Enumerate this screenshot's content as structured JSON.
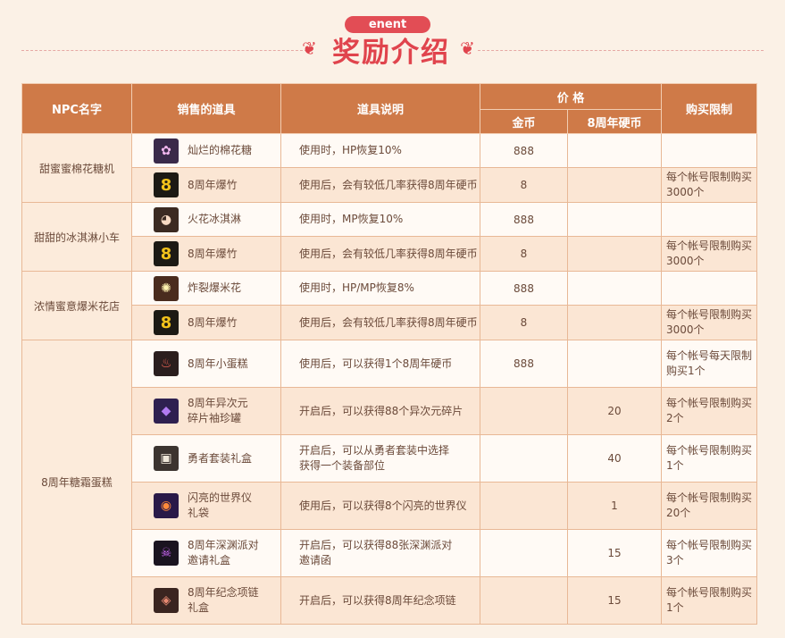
{
  "header": {
    "tag": "enent",
    "title": "奖励介绍"
  },
  "table": {
    "headers": {
      "npc": "NPC名字",
      "item": "销售的道具",
      "desc": "道具说明",
      "price": "价 格",
      "gold": "金币",
      "coin": "8周年硬币",
      "limit": "购买限制"
    },
    "groups": [
      {
        "npc": "甜蜜蜜棉花糖机",
        "rows": [
          {
            "icon": "cotton-candy-icon",
            "name": [
              "灿烂的棉花糖"
            ],
            "desc": [
              "使用时，HP恢复10%"
            ],
            "gold": "888",
            "coin": "",
            "limit": []
          },
          {
            "icon": "firecracker-icon",
            "name": [
              "8周年爆竹"
            ],
            "desc": [
              "使用后，会有较低几率获得8周年硬币"
            ],
            "gold": "8",
            "coin": "",
            "limit": [
              "每个帐号限制购买",
              "3000个"
            ]
          }
        ]
      },
      {
        "npc": "甜甜的冰淇淋小车",
        "rows": [
          {
            "icon": "ice-cream-icon",
            "name": [
              "火花冰淇淋"
            ],
            "desc": [
              "使用时，MP恢复10%"
            ],
            "gold": "888",
            "coin": "",
            "limit": []
          },
          {
            "icon": "firecracker-icon",
            "name": [
              "8周年爆竹"
            ],
            "desc": [
              "使用后，会有较低几率获得8周年硬币"
            ],
            "gold": "8",
            "coin": "",
            "limit": [
              "每个帐号限制购买",
              "3000个"
            ]
          }
        ]
      },
      {
        "npc": "浓情蜜意爆米花店",
        "rows": [
          {
            "icon": "popcorn-icon",
            "name": [
              "炸裂爆米花"
            ],
            "desc": [
              "使用时，HP/MP恢复8%"
            ],
            "gold": "888",
            "coin": "",
            "limit": []
          },
          {
            "icon": "firecracker-icon",
            "name": [
              "8周年爆竹"
            ],
            "desc": [
              "使用后，会有较低几率获得8周年硬币"
            ],
            "gold": "8",
            "coin": "",
            "limit": [
              "每个帐号限制购买",
              "3000个"
            ]
          }
        ]
      },
      {
        "npc": "8周年糖霜蛋糕",
        "rows": [
          {
            "icon": "cake-icon",
            "name": [
              "8周年小蛋糕"
            ],
            "desc": [
              "使用后，可以获得1个8周年硬币"
            ],
            "gold": "888",
            "coin": "",
            "limit": [
              "每个帐号每天限制",
              "购买1个"
            ]
          },
          {
            "icon": "jar-icon",
            "name": [
              "8周年异次元",
              "碎片袖珍罐"
            ],
            "desc": [
              "开启后，可以获得88个异次元碎片"
            ],
            "gold": "",
            "coin": "20",
            "limit": [
              "每个帐号限制购买",
              "2个"
            ]
          },
          {
            "icon": "gift-box-icon",
            "name": [
              "勇者套装礼盒"
            ],
            "desc": [
              "开启后，可以从勇者套装中选择",
              "获得一个装备部位"
            ],
            "gold": "",
            "coin": "40",
            "limit": [
              "每个帐号限制购买",
              "1个"
            ]
          },
          {
            "icon": "orb-icon",
            "name": [
              "闪亮的世界仪",
              "礼袋"
            ],
            "desc": [
              "使用后，可以获得8个闪亮的世界仪"
            ],
            "gold": "",
            "coin": "1",
            "limit": [
              "每个帐号限制购买",
              "20个"
            ]
          },
          {
            "icon": "party-invite-icon",
            "name": [
              "8周年深渊派对",
              "邀请礼盒"
            ],
            "desc": [
              "开启后，可以获得88张深渊派对",
              "邀请函"
            ],
            "gold": "",
            "coin": "15",
            "limit": [
              "每个帐号限制购买",
              "3个"
            ]
          },
          {
            "icon": "necklace-box-icon",
            "name": [
              "8周年纪念项链",
              "礼盒"
            ],
            "desc": [
              "开启后，可以获得8周年纪念项链"
            ],
            "gold": "",
            "coin": "15",
            "limit": [
              "每个帐号限制购买",
              "1个"
            ]
          }
        ]
      }
    ]
  }
}
